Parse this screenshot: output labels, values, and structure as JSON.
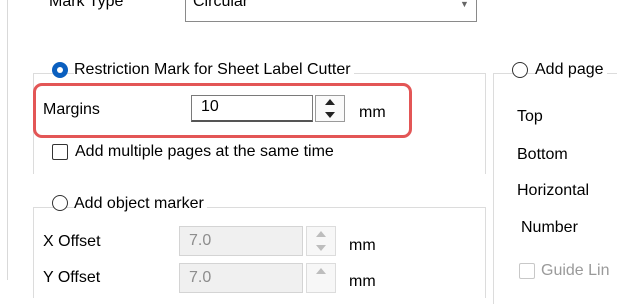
{
  "mark_type": {
    "label": "Mark Type",
    "value": "Circular"
  },
  "restriction": {
    "option_label": "Restriction Mark for Sheet Label Cutter",
    "margins_label": "Margins",
    "margins_value": "10",
    "margins_unit": "mm",
    "multiple_pages_label": "Add multiple pages at the same time"
  },
  "object_marker": {
    "option_label": "Add object marker",
    "x_offset_label": "X Offset",
    "x_offset_value": "7.0",
    "x_offset_unit": "mm",
    "y_offset_label": "Y Offset",
    "y_offset_value": "7.0",
    "y_offset_unit": "mm"
  },
  "add_page": {
    "option_label": "Add page",
    "top_label": "Top",
    "bottom_label": "Bottom",
    "horizontal_label": "Horizontal",
    "number_label": "Number",
    "guide_label": "Guide Lin"
  },
  "colors": {
    "accent": "#0a5fbf",
    "highlight": "#e35656"
  }
}
